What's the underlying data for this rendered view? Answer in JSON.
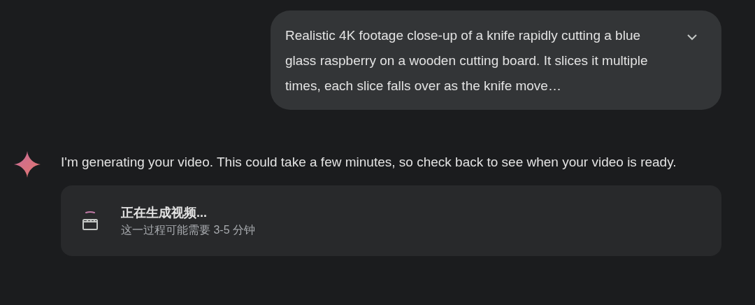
{
  "user_prompt": {
    "text": "Realistic 4K footage close-up of a knife rapidly cutting a blue glass raspberry on a wooden cutting board. It slices it multiple times, each slice falls over as the knife move…",
    "expanded": false
  },
  "response": {
    "text": "I'm generating your video. This could take a few minutes, so check back to see when your video is ready.",
    "status_card": {
      "title": "正在生成视频...",
      "subtitle": "这一过程可能需要 3-5 分钟"
    }
  }
}
